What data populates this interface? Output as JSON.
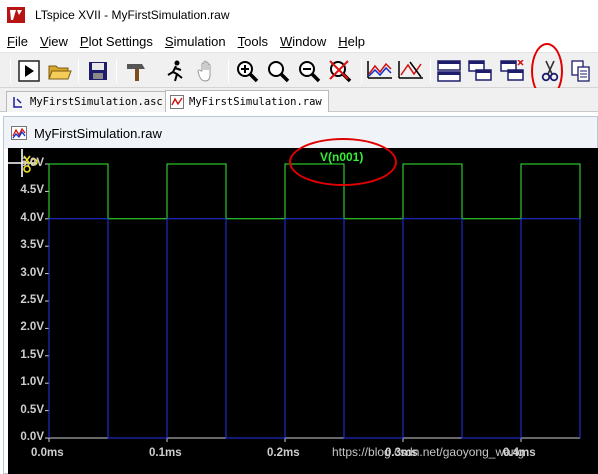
{
  "window": {
    "title": "LTspice XVII - MyFirstSimulation.raw"
  },
  "menu": {
    "items": [
      {
        "name": "menu-file",
        "label": "File"
      },
      {
        "name": "menu-view",
        "label": "View"
      },
      {
        "name": "menu-plot-settings",
        "label": "Plot Settings"
      },
      {
        "name": "menu-simulation",
        "label": "Simulation"
      },
      {
        "name": "menu-tools",
        "label": "Tools"
      },
      {
        "name": "menu-window",
        "label": "Window"
      },
      {
        "name": "menu-help",
        "label": "Help"
      }
    ]
  },
  "toolbar": {
    "buttons": [
      "run-icon",
      "open-icon",
      "save-icon",
      "control-panel-icon",
      "halt-icon",
      "pan-icon",
      "zoom-in-icon",
      "zoom-area-icon",
      "zoom-out-icon",
      "zoom-cancel-icon",
      "autorange-icon",
      "delete-trace-icon",
      "tile-icon",
      "cascade-icon",
      "close-window-icon",
      "cut-icon",
      "copy-icon"
    ]
  },
  "tabs": [
    {
      "label": "MyFirstSimulation.asc",
      "active": false
    },
    {
      "label": "MyFirstSimulation.raw",
      "active": true
    }
  ],
  "plot_window": {
    "title": "MyFirstSimulation.raw",
    "trace_label": "V(n001)"
  },
  "watermark": "https://blog.csdn.net/gaoyong_wang",
  "chart_data": {
    "type": "line",
    "title": "",
    "xlabel": "",
    "ylabel": "",
    "xlim": [
      0.0,
      0.45
    ],
    "ylim": [
      0.0,
      5.0
    ],
    "x_ticks": [
      "0.0ms",
      "0.1ms",
      "0.2ms",
      "0.3ms",
      "0.4ms"
    ],
    "x_tick_values": [
      0.0,
      0.1,
      0.2,
      0.3,
      0.4
    ],
    "y_ticks": [
      "0.0V",
      "0.5V",
      "1.0V",
      "1.5V",
      "2.0V",
      "2.5V",
      "3.0V",
      "3.5V",
      "4.0V",
      "4.5V",
      "5.0V"
    ],
    "y_tick_values": [
      0.0,
      0.5,
      1.0,
      1.5,
      2.0,
      2.5,
      3.0,
      3.5,
      4.0,
      4.5,
      5.0
    ],
    "series": [
      {
        "name": "V(n001)",
        "color": "#33ee33",
        "x": [
          0.0,
          0.0,
          0.05,
          0.05,
          0.1,
          0.1,
          0.15,
          0.15,
          0.2,
          0.2,
          0.25,
          0.25,
          0.3,
          0.3,
          0.35,
          0.35,
          0.4,
          0.4,
          0.45,
          0.45
        ],
        "y": [
          4.0,
          5.0,
          5.0,
          4.0,
          4.0,
          5.0,
          5.0,
          4.0,
          4.0,
          5.0,
          5.0,
          4.0,
          4.0,
          5.0,
          5.0,
          4.0,
          4.0,
          5.0,
          5.0,
          4.0
        ]
      },
      {
        "color": "#2233ee",
        "x": [
          0.0,
          0.0,
          0.05,
          0.05,
          0.1,
          0.1,
          0.15,
          0.15,
          0.2,
          0.2,
          0.25,
          0.25,
          0.3,
          0.3,
          0.35,
          0.35,
          0.4,
          0.4,
          0.45,
          0.45
        ],
        "y": [
          0.0,
          4.0,
          4.0,
          0.0,
          0.0,
          4.0,
          4.0,
          0.0,
          0.0,
          4.0,
          4.0,
          0.0,
          0.0,
          4.0,
          4.0,
          0.0,
          0.0,
          4.0,
          4.0,
          0.0
        ]
      }
    ],
    "grid": false
  },
  "colors": {
    "plot_background": "#000000",
    "axis": "#cfcfcf",
    "annotation": "#e00000"
  }
}
